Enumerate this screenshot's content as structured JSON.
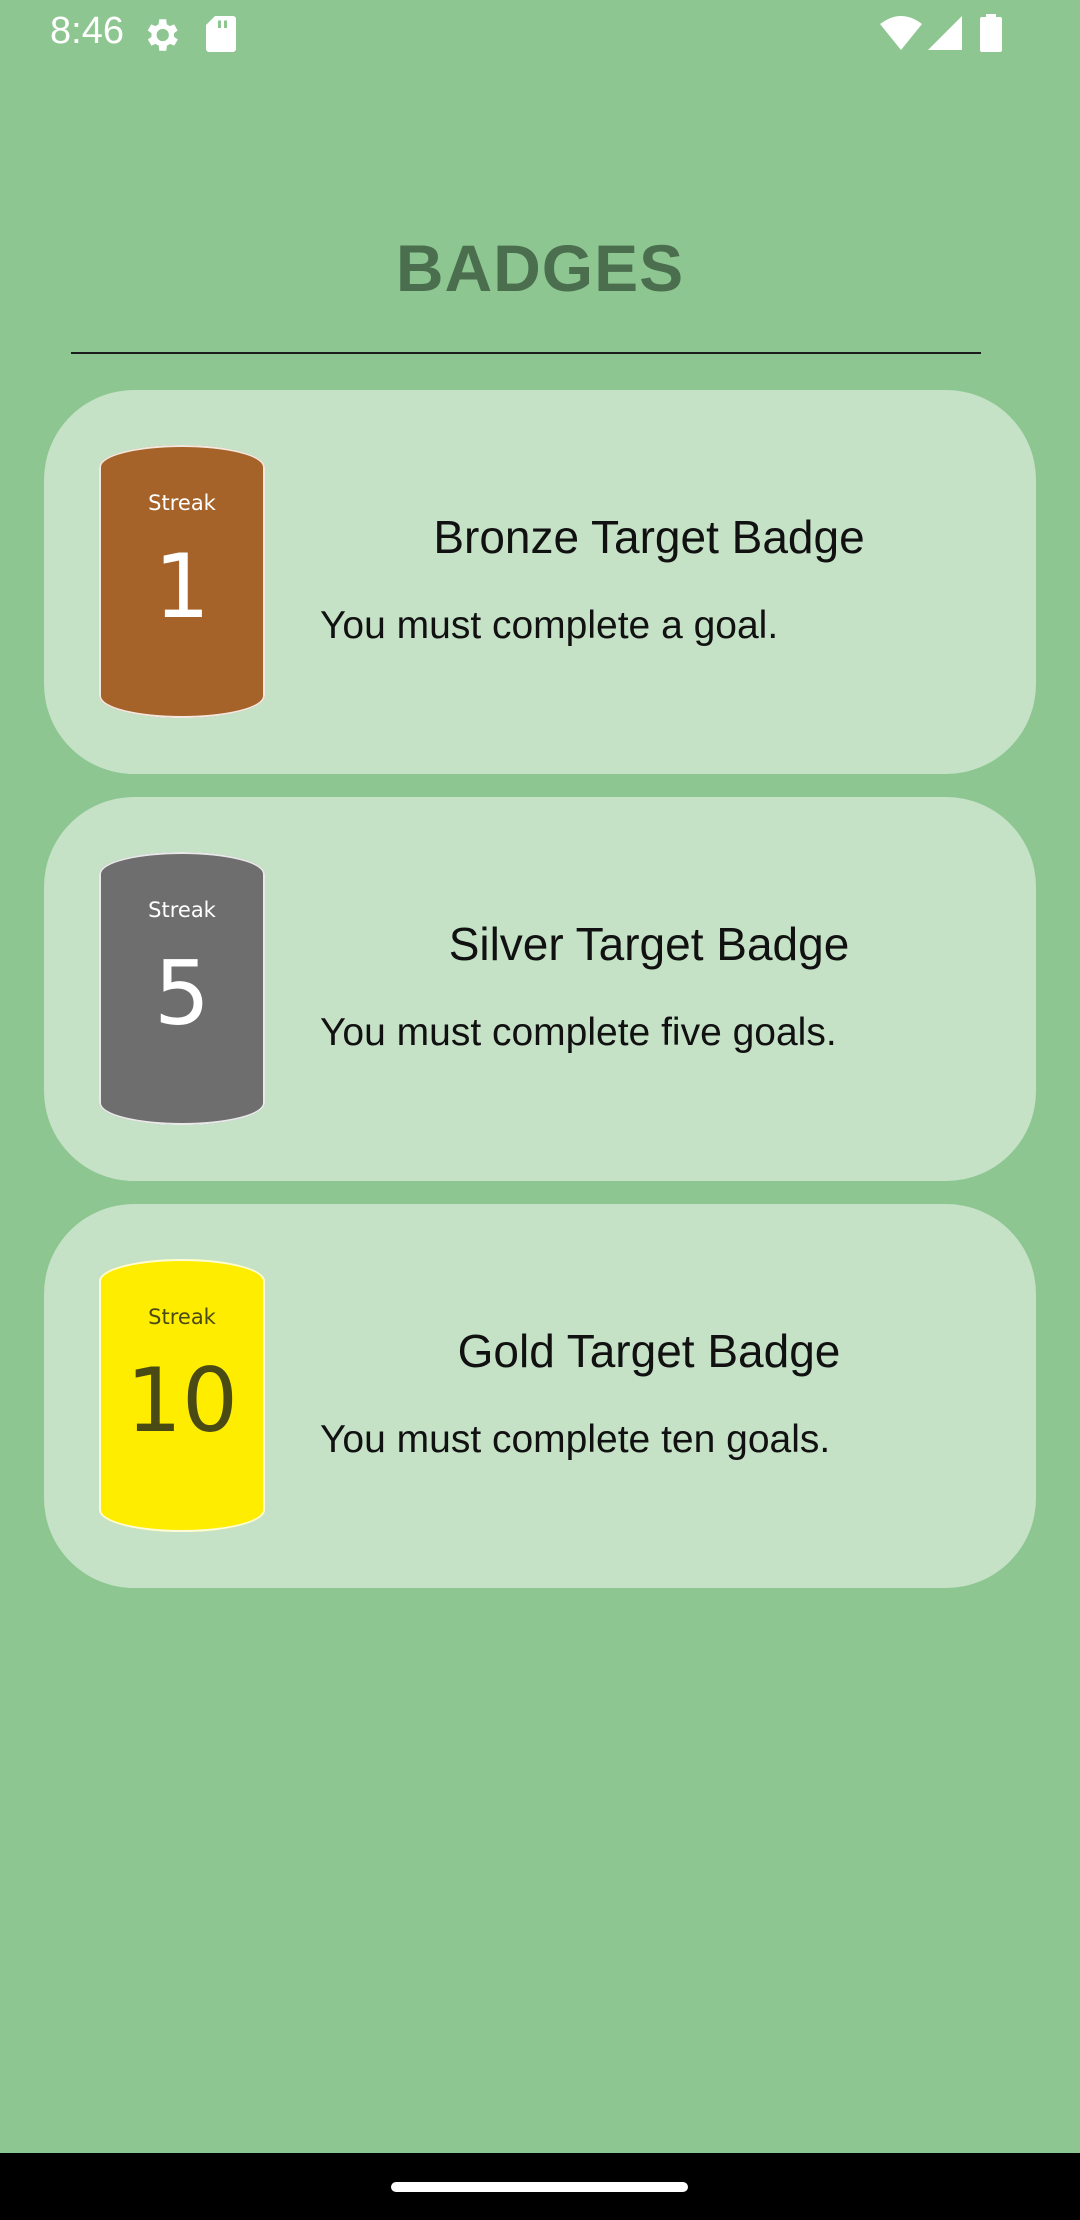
{
  "status_bar": {
    "time": "8:46",
    "icons": [
      "settings-icon",
      "sd-card-icon",
      "wifi-icon",
      "cell-signal-icon",
      "battery-icon"
    ]
  },
  "page": {
    "title": "BADGES",
    "background_color": "#8DC690",
    "title_color": "#4A6E4E",
    "card_color": "#C5E2C7"
  },
  "badges": [
    {
      "streak_label": "Streak",
      "streak_value": "1",
      "title": "Bronze Target Badge",
      "description": "You must complete a goal.",
      "color": "#A5632A",
      "text_color": "#ffffff"
    },
    {
      "streak_label": "Streak",
      "streak_value": "5",
      "title": "Silver Target Badge",
      "description": "You must complete five goals.",
      "color": "#6E6E6E",
      "text_color": "#ffffff"
    },
    {
      "streak_label": "Streak",
      "streak_value": "10",
      "title": "Gold Target Badge",
      "description": "You must complete ten goals.",
      "color": "#FFED00",
      "text_color": "#4A4A14"
    }
  ]
}
